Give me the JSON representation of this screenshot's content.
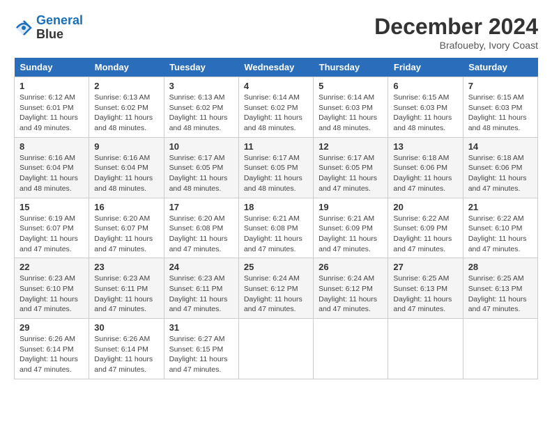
{
  "header": {
    "logo_line1": "General",
    "logo_line2": "Blue",
    "month": "December 2024",
    "location": "Brafoueby, Ivory Coast"
  },
  "days_of_week": [
    "Sunday",
    "Monday",
    "Tuesday",
    "Wednesday",
    "Thursday",
    "Friday",
    "Saturday"
  ],
  "weeks": [
    [
      {
        "day": "1",
        "info": "Sunrise: 6:12 AM\nSunset: 6:01 PM\nDaylight: 11 hours\nand 49 minutes."
      },
      {
        "day": "2",
        "info": "Sunrise: 6:13 AM\nSunset: 6:02 PM\nDaylight: 11 hours\nand 48 minutes."
      },
      {
        "day": "3",
        "info": "Sunrise: 6:13 AM\nSunset: 6:02 PM\nDaylight: 11 hours\nand 48 minutes."
      },
      {
        "day": "4",
        "info": "Sunrise: 6:14 AM\nSunset: 6:02 PM\nDaylight: 11 hours\nand 48 minutes."
      },
      {
        "day": "5",
        "info": "Sunrise: 6:14 AM\nSunset: 6:03 PM\nDaylight: 11 hours\nand 48 minutes."
      },
      {
        "day": "6",
        "info": "Sunrise: 6:15 AM\nSunset: 6:03 PM\nDaylight: 11 hours\nand 48 minutes."
      },
      {
        "day": "7",
        "info": "Sunrise: 6:15 AM\nSunset: 6:03 PM\nDaylight: 11 hours\nand 48 minutes."
      }
    ],
    [
      {
        "day": "8",
        "info": "Sunrise: 6:16 AM\nSunset: 6:04 PM\nDaylight: 11 hours\nand 48 minutes."
      },
      {
        "day": "9",
        "info": "Sunrise: 6:16 AM\nSunset: 6:04 PM\nDaylight: 11 hours\nand 48 minutes."
      },
      {
        "day": "10",
        "info": "Sunrise: 6:17 AM\nSunset: 6:05 PM\nDaylight: 11 hours\nand 48 minutes."
      },
      {
        "day": "11",
        "info": "Sunrise: 6:17 AM\nSunset: 6:05 PM\nDaylight: 11 hours\nand 48 minutes."
      },
      {
        "day": "12",
        "info": "Sunrise: 6:17 AM\nSunset: 6:05 PM\nDaylight: 11 hours\nand 47 minutes."
      },
      {
        "day": "13",
        "info": "Sunrise: 6:18 AM\nSunset: 6:06 PM\nDaylight: 11 hours\nand 47 minutes."
      },
      {
        "day": "14",
        "info": "Sunrise: 6:18 AM\nSunset: 6:06 PM\nDaylight: 11 hours\nand 47 minutes."
      }
    ],
    [
      {
        "day": "15",
        "info": "Sunrise: 6:19 AM\nSunset: 6:07 PM\nDaylight: 11 hours\nand 47 minutes."
      },
      {
        "day": "16",
        "info": "Sunrise: 6:20 AM\nSunset: 6:07 PM\nDaylight: 11 hours\nand 47 minutes."
      },
      {
        "day": "17",
        "info": "Sunrise: 6:20 AM\nSunset: 6:08 PM\nDaylight: 11 hours\nand 47 minutes."
      },
      {
        "day": "18",
        "info": "Sunrise: 6:21 AM\nSunset: 6:08 PM\nDaylight: 11 hours\nand 47 minutes."
      },
      {
        "day": "19",
        "info": "Sunrise: 6:21 AM\nSunset: 6:09 PM\nDaylight: 11 hours\nand 47 minutes."
      },
      {
        "day": "20",
        "info": "Sunrise: 6:22 AM\nSunset: 6:09 PM\nDaylight: 11 hours\nand 47 minutes."
      },
      {
        "day": "21",
        "info": "Sunrise: 6:22 AM\nSunset: 6:10 PM\nDaylight: 11 hours\nand 47 minutes."
      }
    ],
    [
      {
        "day": "22",
        "info": "Sunrise: 6:23 AM\nSunset: 6:10 PM\nDaylight: 11 hours\nand 47 minutes."
      },
      {
        "day": "23",
        "info": "Sunrise: 6:23 AM\nSunset: 6:11 PM\nDaylight: 11 hours\nand 47 minutes."
      },
      {
        "day": "24",
        "info": "Sunrise: 6:23 AM\nSunset: 6:11 PM\nDaylight: 11 hours\nand 47 minutes."
      },
      {
        "day": "25",
        "info": "Sunrise: 6:24 AM\nSunset: 6:12 PM\nDaylight: 11 hours\nand 47 minutes."
      },
      {
        "day": "26",
        "info": "Sunrise: 6:24 AM\nSunset: 6:12 PM\nDaylight: 11 hours\nand 47 minutes."
      },
      {
        "day": "27",
        "info": "Sunrise: 6:25 AM\nSunset: 6:13 PM\nDaylight: 11 hours\nand 47 minutes."
      },
      {
        "day": "28",
        "info": "Sunrise: 6:25 AM\nSunset: 6:13 PM\nDaylight: 11 hours\nand 47 minutes."
      }
    ],
    [
      {
        "day": "29",
        "info": "Sunrise: 6:26 AM\nSunset: 6:14 PM\nDaylight: 11 hours\nand 47 minutes."
      },
      {
        "day": "30",
        "info": "Sunrise: 6:26 AM\nSunset: 6:14 PM\nDaylight: 11 hours\nand 47 minutes."
      },
      {
        "day": "31",
        "info": "Sunrise: 6:27 AM\nSunset: 6:15 PM\nDaylight: 11 hours\nand 47 minutes."
      },
      {
        "day": "",
        "info": ""
      },
      {
        "day": "",
        "info": ""
      },
      {
        "day": "",
        "info": ""
      },
      {
        "day": "",
        "info": ""
      }
    ]
  ]
}
